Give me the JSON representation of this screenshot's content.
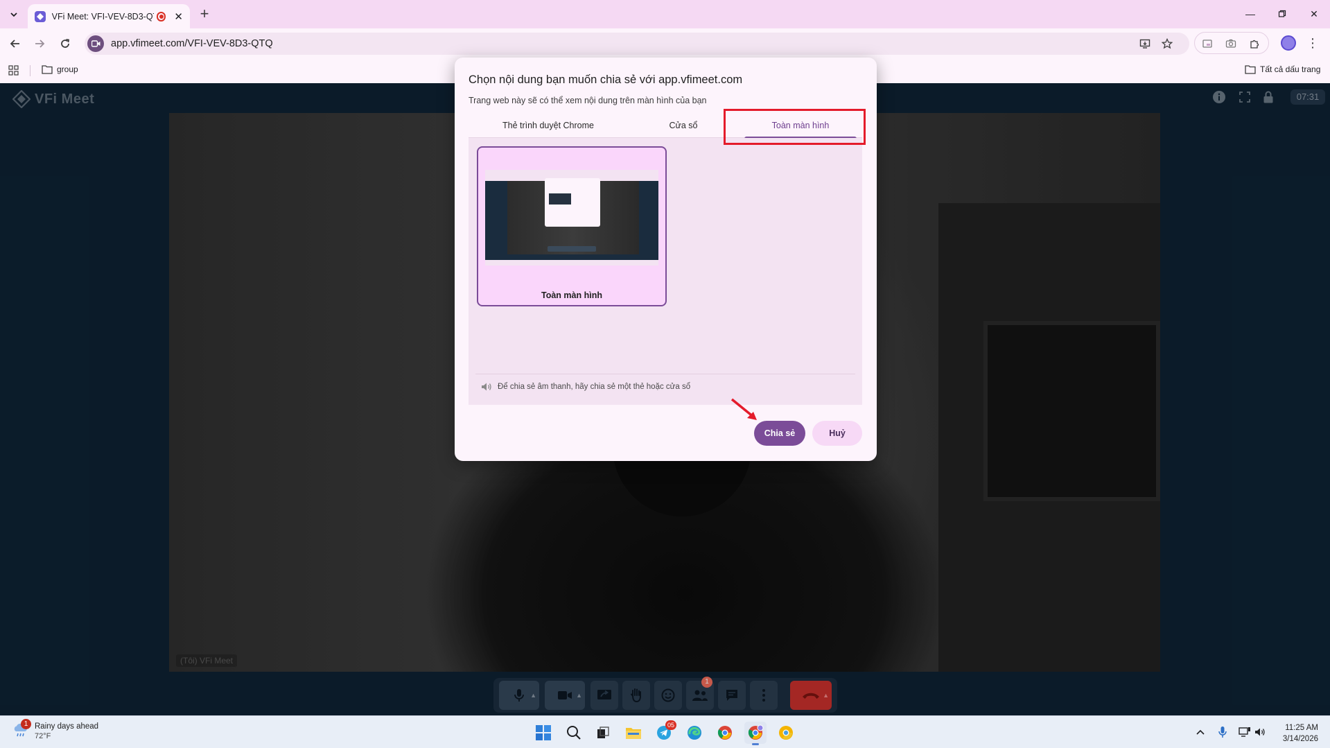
{
  "browser": {
    "tab_title": "VFi Meet: VFI-VEV-8D3-QTQ",
    "url": "app.vfimeet.com/VFI-VEV-8D3-QTQ",
    "bookmark_folder": "group",
    "all_bookmarks": "Tất cả dấu trang"
  },
  "meet": {
    "logo_text": "VFi Meet",
    "timer": "07:31",
    "self_label": "(Tôi) VFi Meet",
    "participants_badge": "1"
  },
  "dialog": {
    "title": "Chọn nội dung bạn muốn chia sẻ với app.vfimeet.com",
    "subtitle": "Trang web này sẽ có thể xem nội dung trên màn hình của bạn",
    "tabs": [
      {
        "label": "Thẻ trình duyệt Chrome"
      },
      {
        "label": "Cửa sổ"
      },
      {
        "label": "Toàn màn hình"
      }
    ],
    "active_tab": "Toàn màn hình",
    "screen_option_label": "Toàn màn hình",
    "audio_note": "Để chia sẻ âm thanh, hãy chia sẻ một thẻ hoặc cửa sổ",
    "share_button": "Chia sẻ",
    "cancel_button": "Huỷ"
  },
  "taskbar": {
    "weather_title": "Rainy days ahead",
    "weather_temp": "72°F",
    "weather_badge": "1",
    "telegram_badge": "05",
    "time": "11:25 AM",
    "date": "3/14/2026"
  },
  "colors": {
    "accent": "#7b4c98",
    "highlight_box": "#e41b2b",
    "tabstrip": "#f5d9f3",
    "meet_bg": "#0e2233"
  }
}
